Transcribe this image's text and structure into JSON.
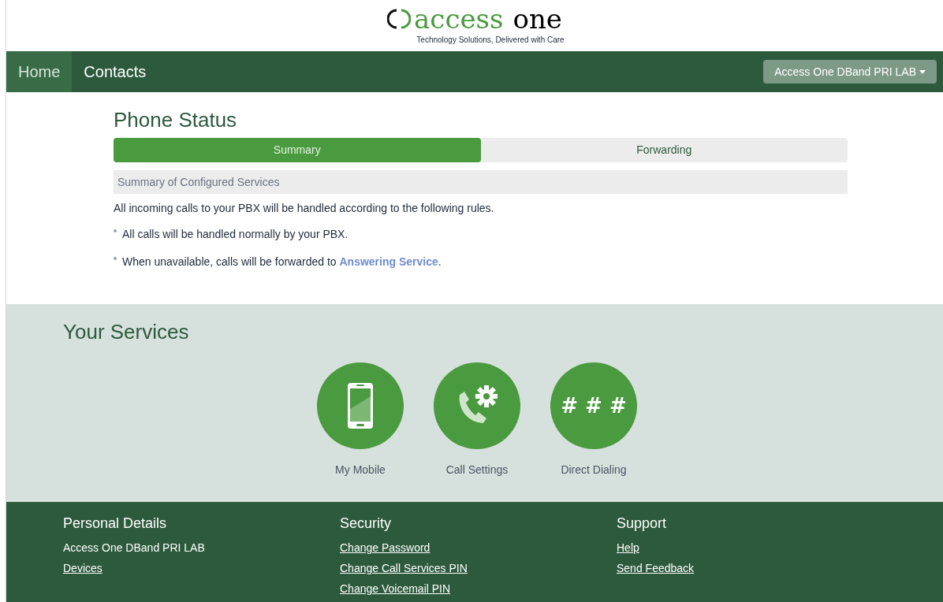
{
  "logo": {
    "word_1": "access",
    "word_2": "one",
    "tagline": "Technology Solutions, Delivered with Care"
  },
  "nav": {
    "items": [
      {
        "label": "Home",
        "selected": true
      },
      {
        "label": "Contacts",
        "selected": false
      }
    ],
    "account_menu": "Access One DBand PRI LAB"
  },
  "phone_status": {
    "title": "Phone Status",
    "tabs": [
      {
        "label": "Summary",
        "selected": true
      },
      {
        "label": "Forwarding",
        "selected": false
      }
    ],
    "panel_heading": "Summary of Configured Services",
    "intro": "All incoming calls to your PBX will be handled according to the following rules.",
    "rules": [
      {
        "text": "All calls will be handled normally by your PBX."
      },
      {
        "text": "When unavailable, calls will be forwarded to ",
        "link": "Answering Service",
        "after": "."
      }
    ]
  },
  "services": {
    "title": "Your Services",
    "items": [
      {
        "kind": "mobile",
        "label": "My Mobile"
      },
      {
        "kind": "call-settings",
        "label": "Call Settings"
      },
      {
        "kind": "dialing",
        "label": "Direct Dialing",
        "glyph": "# # #"
      }
    ]
  },
  "footer": {
    "columns": [
      {
        "title": "Personal Details",
        "items": [
          {
            "kind": "text",
            "label": "Access One DBand PRI LAB"
          },
          {
            "kind": "link",
            "label": "Devices"
          }
        ]
      },
      {
        "title": "Security",
        "items": [
          {
            "kind": "link",
            "label": "Change Password"
          },
          {
            "kind": "link",
            "label": "Change Call Services PIN"
          },
          {
            "kind": "link",
            "label": "Change Voicemail PIN"
          }
        ]
      },
      {
        "title": "Support",
        "items": [
          {
            "kind": "link",
            "label": "Help"
          },
          {
            "kind": "link",
            "label": "Send Feedback"
          }
        ]
      }
    ]
  }
}
